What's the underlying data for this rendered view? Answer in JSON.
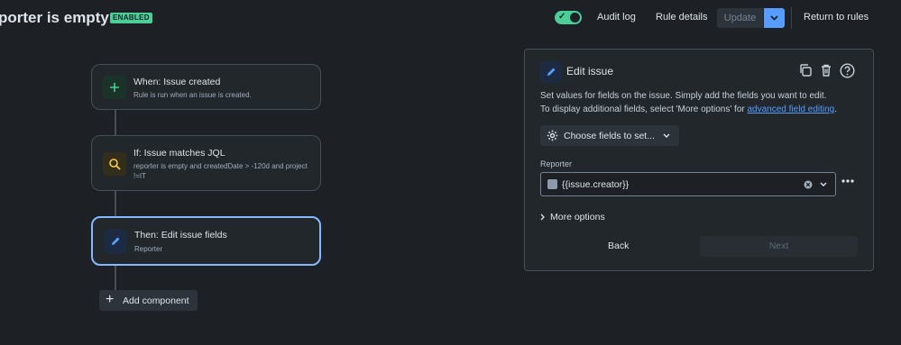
{
  "header": {
    "title": "porter is empty",
    "status": "ENABLED",
    "links": {
      "audit_log": "Audit log",
      "rule_details": "Rule details",
      "update": "Update",
      "return_to_rules": "Return to rules"
    },
    "rule_enabled": true
  },
  "flow": {
    "components": [
      {
        "title": "When: Issue created",
        "subtitle": "Rule is run when an issue is created.",
        "icon": "plus-icon",
        "color": "#4bce97"
      },
      {
        "title": "If: Issue matches JQL",
        "subtitle": "reporter is empty and createdDate > -120d and project !=IT",
        "icon": "search-icon",
        "color": "#f5cd47"
      },
      {
        "title": "Then: Edit issue fields",
        "subtitle": "Reporter",
        "icon": "pencil-icon",
        "color": "#579dff",
        "selected": true
      }
    ],
    "add_component": "Add component"
  },
  "panel": {
    "title": "Edit issue",
    "description_line1": "Set values for fields on the issue. Simply add the fields you want to edit.",
    "description_line2_prefix": "To display additional fields, select 'More options' for ",
    "description_link": "advanced field editing",
    "description_line2_suffix": ".",
    "choose_fields": "Choose fields to set...",
    "field_label": "Reporter",
    "field_value": "{{issue.creator}}",
    "more_options": "More options",
    "back": "Back",
    "next": "Next"
  }
}
